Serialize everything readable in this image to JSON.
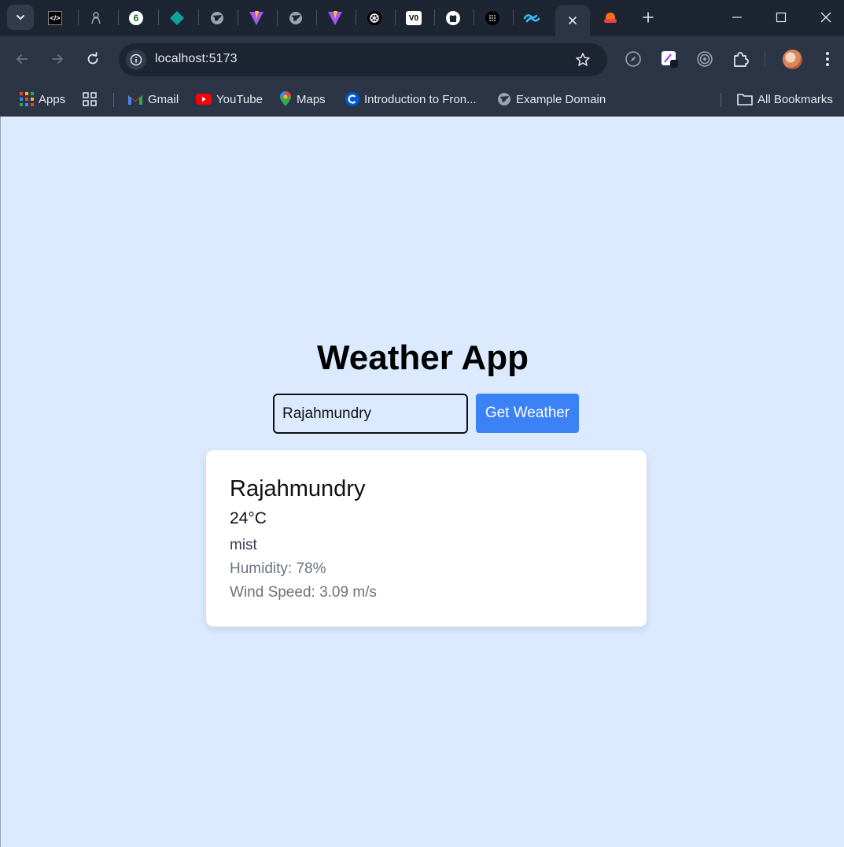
{
  "browser": {
    "url": "localhost:5173",
    "tabs": [
      {
        "icon": "dark-code-icon"
      },
      {
        "icon": "figure-icon"
      },
      {
        "icon": "green-six-icon"
      },
      {
        "icon": "teal-diamond-icon"
      },
      {
        "icon": "globe-icon"
      },
      {
        "icon": "vite-icon"
      },
      {
        "icon": "globe-icon"
      },
      {
        "icon": "vite-icon"
      },
      {
        "icon": "openai-icon"
      },
      {
        "icon": "v0-icon"
      },
      {
        "icon": "github-icon"
      },
      {
        "icon": "dots-icon"
      },
      {
        "icon": "tailwind-icon"
      },
      {
        "icon": "close-icon"
      },
      {
        "icon": "cloud-sun-icon"
      }
    ],
    "bookmarks": {
      "apps": "Apps",
      "gmail": "Gmail",
      "youtube": "YouTube",
      "maps": "Maps",
      "intro": "Introduction to Fron...",
      "example": "Example Domain",
      "all": "All Bookmarks"
    }
  },
  "app": {
    "title": "Weather App",
    "input_value": "Rajahmundry",
    "button_label": "Get Weather",
    "result": {
      "city": "Rajahmundry",
      "temperature": "24°C",
      "description": "mist",
      "humidity": "Humidity: 78%",
      "wind": "Wind Speed: 3.09 m/s"
    }
  },
  "colors": {
    "page_background": "#dbeafe",
    "button": "#3b82f6",
    "chrome_dark": "#1d2533",
    "chrome": "#2c3545"
  }
}
